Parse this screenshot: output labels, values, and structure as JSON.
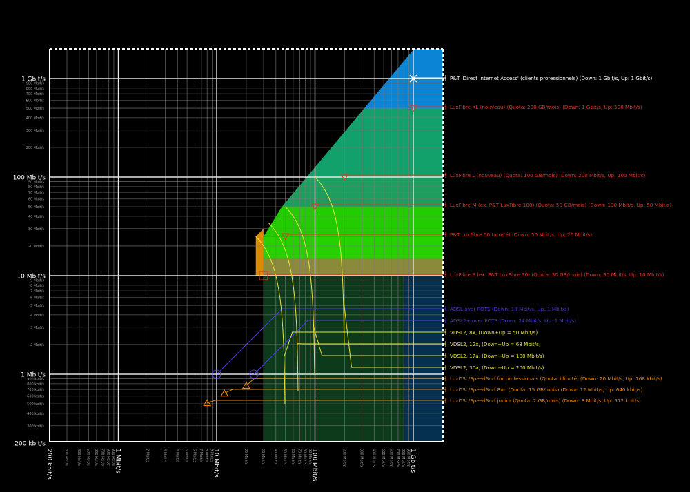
{
  "chart_data": {
    "type": "scatter",
    "title": "",
    "xlabel": "",
    "ylabel": "",
    "x_scale": "log",
    "y_scale": "log",
    "xlim": [
      "200 kbit/s",
      "2 Gbit/s"
    ],
    "ylim": [
      "200 kbit/s",
      "1.5 Gbit/s"
    ],
    "x_major_ticks": [
      {
        "label": "200 kbit/s",
        "value_kbps": 200
      },
      {
        "label": "1 Mbit/s",
        "value_kbps": 1000
      },
      {
        "label": "10 Mbit/s",
        "value_kbps": 10000
      },
      {
        "label": "100 Mbit/s",
        "value_kbps": 100000
      },
      {
        "label": "1 Gbit/s",
        "value_kbps": 1000000
      }
    ],
    "x_minor_ticks": [
      {
        "label": "300 kbit/s",
        "value_kbps": 300
      },
      {
        "label": "400 kbit/s",
        "value_kbps": 400
      },
      {
        "label": "500 kbit/s",
        "value_kbps": 500
      },
      {
        "label": "600 kbit/s",
        "value_kbps": 600
      },
      {
        "label": "700 kbit/s",
        "value_kbps": 700
      },
      {
        "label": "800 kbit/s",
        "value_kbps": 800
      },
      {
        "label": "900 kbit/s",
        "value_kbps": 900
      },
      {
        "label": "2 Mbit/s",
        "value_kbps": 2000
      },
      {
        "label": "3 Mbit/s",
        "value_kbps": 3000
      },
      {
        "label": "4 Mbit/s",
        "value_kbps": 4000
      },
      {
        "label": "5 Mbit/s",
        "value_kbps": 5000
      },
      {
        "label": "6 Mbit/s",
        "value_kbps": 6000
      },
      {
        "label": "7 Mbit/s",
        "value_kbps": 7000
      },
      {
        "label": "8 Mbit/s",
        "value_kbps": 8000
      },
      {
        "label": "9 Mbit/s",
        "value_kbps": 9000
      },
      {
        "label": "20 Mbit/s",
        "value_kbps": 20000
      },
      {
        "label": "30 Mbit/s",
        "value_kbps": 30000
      },
      {
        "label": "40 Mbit/s",
        "value_kbps": 40000
      },
      {
        "label": "50 Mbit/s",
        "value_kbps": 50000
      },
      {
        "label": "60 Mbit/s",
        "value_kbps": 60000
      },
      {
        "label": "70 Mbit/s",
        "value_kbps": 70000
      },
      {
        "label": "80 Mbit/s",
        "value_kbps": 80000
      },
      {
        "label": "90 Mbit/s",
        "value_kbps": 90000
      },
      {
        "label": "200 Mbit/s",
        "value_kbps": 200000
      },
      {
        "label": "300 Mbit/s",
        "value_kbps": 300000
      },
      {
        "label": "400 Mbit/s",
        "value_kbps": 400000
      },
      {
        "label": "500 Mbit/s",
        "value_kbps": 500000
      },
      {
        "label": "600 Mbit/s",
        "value_kbps": 600000
      },
      {
        "label": "700 Mbit/s",
        "value_kbps": 700000
      },
      {
        "label": "800 Mbit/s",
        "value_kbps": 800000
      },
      {
        "label": "900 Mbit/s",
        "value_kbps": 900000
      }
    ],
    "y_major_ticks": [
      {
        "label": "200 kbit/s",
        "value_kbps": 200
      },
      {
        "label": "1 Mbit/s",
        "value_kbps": 1000
      },
      {
        "label": "10 Mbit/s",
        "value_kbps": 10000
      },
      {
        "label": "100 Mbit/s",
        "value_kbps": 100000
      },
      {
        "label": "1 Gbit/s",
        "value_kbps": 1000000
      }
    ],
    "y_minor_ticks": [
      {
        "label": "300 kbit/s",
        "value_kbps": 300
      },
      {
        "label": "400 kbit/s",
        "value_kbps": 400
      },
      {
        "label": "500 kbit/s",
        "value_kbps": 500
      },
      {
        "label": "600 kbit/s",
        "value_kbps": 600
      },
      {
        "label": "700 kbit/s",
        "value_kbps": 700
      },
      {
        "label": "800 kbit/s",
        "value_kbps": 800
      },
      {
        "label": "900 kbit/s",
        "value_kbps": 900
      },
      {
        "label": "2 Mbit/s",
        "value_kbps": 2000
      },
      {
        "label": "3 Mbit/s",
        "value_kbps": 3000
      },
      {
        "label": "4 Mbit/s",
        "value_kbps": 4000
      },
      {
        "label": "5 Mbit/s",
        "value_kbps": 5000
      },
      {
        "label": "6 Mbit/s",
        "value_kbps": 6000
      },
      {
        "label": "7 Mbit/s",
        "value_kbps": 7000
      },
      {
        "label": "8 Mbit/s",
        "value_kbps": 8000
      },
      {
        "label": "9 Mbit/s",
        "value_kbps": 9000
      },
      {
        "label": "20 Mbit/s",
        "value_kbps": 20000
      },
      {
        "label": "30 Mbit/s",
        "value_kbps": 30000
      },
      {
        "label": "40 Mbit/s",
        "value_kbps": 40000
      },
      {
        "label": "50 Mbit/s",
        "value_kbps": 50000
      },
      {
        "label": "60 Mbit/s",
        "value_kbps": 60000
      },
      {
        "label": "70 Mbit/s",
        "value_kbps": 70000
      },
      {
        "label": "80 Mbit/s",
        "value_kbps": 80000
      },
      {
        "label": "90 Mbit/s",
        "value_kbps": 90000
      },
      {
        "label": "200 Mbit/s",
        "value_kbps": 200000
      },
      {
        "label": "300 Mbit/s",
        "value_kbps": 300000
      },
      {
        "label": "400 Mbit/s",
        "value_kbps": 400000
      },
      {
        "label": "500 Mbit/s",
        "value_kbps": 500000
      },
      {
        "label": "600 Mbit/s",
        "value_kbps": 600000
      },
      {
        "label": "700 Mbit/s",
        "value_kbps": 700000
      },
      {
        "label": "800 Mbit/s",
        "value_kbps": 800000
      },
      {
        "label": "900 Mbit/s",
        "value_kbps": 900000
      }
    ],
    "grid": true,
    "regions": [
      {
        "name": "Gbit region",
        "color": "#0a85d5",
        "x_min_kbps": 800000,
        "y_min_kbps": 500000
      },
      {
        "name": "LuxFibre XL band",
        "color": "#12a06b",
        "y_min_kbps": 100000,
        "y_max_kbps": 500000
      },
      {
        "name": "LuxFibre L band",
        "color": "#1c9e5e",
        "y_min_kbps": 50000,
        "y_max_kbps": 100000
      },
      {
        "name": "LuxFibre M band",
        "color": "#22cc00",
        "y_min_kbps": 25000,
        "y_max_kbps": 50000
      },
      {
        "name": "LuxFibre 50 band",
        "color": "#27d100",
        "y_min_kbps": 15000,
        "y_max_kbps": 25000
      },
      {
        "name": "LuxFibre S band",
        "color": "#8a8a3a",
        "y_min_kbps": 10000,
        "y_max_kbps": 15000
      },
      {
        "name": "Lower green region",
        "color": "#0d3a1a",
        "x_min_kbps": 30000,
        "x_max_kbps": 800000,
        "y_max_kbps": 10000
      },
      {
        "name": "Lower blue region",
        "color": "#05304f",
        "x_min_kbps": 800000,
        "y_max_kbps": 10000
      },
      {
        "name": "Orange step",
        "color": "#d88a00",
        "x_min_kbps": 25000,
        "x_max_kbps": 30000,
        "y_min_kbps": 10000,
        "y_max_kbps": 30000
      }
    ],
    "offers": [
      {
        "label": "P&T 'Direct Internet Access' (clients professionnels) (Down: 1 Gbit/s, Up: 1 Gbit/s)",
        "down_kbps": 1000000,
        "up_kbps": 1000000,
        "marker": "star",
        "color": "#ffffff"
      },
      {
        "label": "LuxFibre XL (nouveau) (Quota: 200 GB/mois) (Down: 1 Gbit/s, Up: 500 Mbit/s)",
        "down_kbps": 1000000,
        "up_kbps": 500000,
        "marker": "triangle-down",
        "color": "#e0392b"
      },
      {
        "label": "LuxFibre L (nouveau) (Quota: 100 GB/mois) (Down: 200 Mbit/s, Up: 100 Mbit/s)",
        "down_kbps": 200000,
        "up_kbps": 100000,
        "marker": "triangle-down",
        "color": "#e0392b"
      },
      {
        "label": "LuxFibre M (ex. P&T LuxFibre 100) (Quota: 50 GB/mois) (Down: 100 Mbit/s, Up: 50 Mbit/s)",
        "down_kbps": 100000,
        "up_kbps": 50000,
        "marker": "triangle-down",
        "color": "#e0392b"
      },
      {
        "label": "P&T LuxFibre 50 (arrêté) (Down: 50 Mbit/s, Up: 25 Mbit/s)",
        "down_kbps": 50000,
        "up_kbps": 25000,
        "marker": "triangle-down",
        "color": "#e0392b"
      },
      {
        "label": "LuxFibre S (ex. P&T LuxFibre 30) (Quota: 30 GB/mois) (Down: 30 Mbit/s, Up: 10 Mbit/s)",
        "down_kbps": 30000,
        "up_kbps": 10000,
        "marker": "square",
        "color": "#e0392b"
      },
      {
        "label": "ADSL over POTS (Down: 10 Mbit/s, Up: 1 Mbit/s)",
        "down_kbps": 10000,
        "up_kbps": 1000,
        "marker": "circle",
        "color": "#4b3cdc"
      },
      {
        "label": "ADSL2+ over POTS (Down: 24 Mbit/s, Up: 1 Mbit/s)",
        "down_kbps": 24000,
        "up_kbps": 1000,
        "marker": "circle",
        "color": "#4b3cdc"
      },
      {
        "label": "VDSL2, 8x, (Down+Up = 50 Mbit/s)",
        "sum_kbps": 50000,
        "marker": "curve",
        "color": "#e8e23a"
      },
      {
        "label": "VDSL2, 12x, (Down+Up = 68 Mbit/s)",
        "sum_kbps": 68000,
        "marker": "curve",
        "color": "#e8e23a"
      },
      {
        "label": "VDSL2, 17a, (Down+Up = 100 Mbit/s)",
        "sum_kbps": 100000,
        "marker": "curve",
        "color": "#e8e23a"
      },
      {
        "label": "VDSL2, 30a, (Down+Up = 200 Mbit/s)",
        "sum_kbps": 200000,
        "marker": "curve",
        "color": "#e8e23a"
      },
      {
        "label": "LuxDSL/SpeedSurf for professionals (Quota: illimité) (Down: 20 Mbit/s, Up: 768 kbit/s)",
        "down_kbps": 20000,
        "up_kbps": 768,
        "marker": "triangle-up",
        "color": "#e8860f"
      },
      {
        "label": "LuxDSL/SpeedSurf Run (Quota: 15 GB/mois) (Down: 12 Mbit/s, Up: 640 kbit/s)",
        "down_kbps": 12000,
        "up_kbps": 640,
        "marker": "triangle-up",
        "color": "#e8860f"
      },
      {
        "label": "LuxDSL/SpeedSurf junior (Quota: 2 GB/mois) (Down: 8 Mbit/s, Up: 512 kbit/s)",
        "down_kbps": 8000,
        "up_kbps": 512,
        "marker": "triangle-up",
        "color": "#e8860f"
      }
    ]
  }
}
